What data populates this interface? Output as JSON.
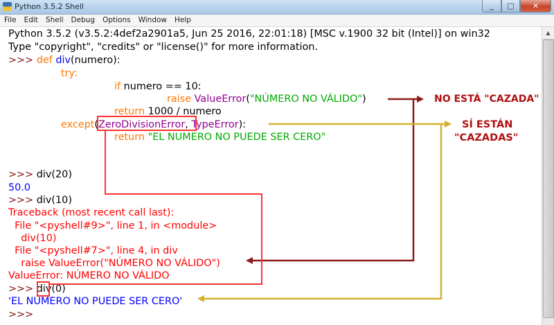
{
  "window": {
    "title": "Python 3.5.2 Shell",
    "minimize": "_",
    "maximize": "□",
    "close": "✕"
  },
  "menu": [
    "File",
    "Edit",
    "Shell",
    "Debug",
    "Options",
    "Window",
    "Help"
  ],
  "shell": {
    "banner1": "Python 3.5.2 (v3.5.2:4def2a2901a5, Jun 25 2016, 22:01:18) [MSC v.1900 32 bit (Intel)] on win32",
    "banner2": "Type \"copyright\", \"credits\" or \"license()\" for more information.",
    "prompt": ">>> ",
    "def_kw": "def",
    "def_name": "div",
    "def_rest": "(numero):",
    "try_kw": "try:",
    "if_kw": "if",
    "if_rest": " numero == 10:",
    "raise_kw": "raise",
    "raise_cls": "ValueError",
    "raise_str": "\"NÚMERO NO VÁLIDO\"",
    "return_kw": "return",
    "return_rest": " 1000 / numero",
    "except_kw": "except",
    "except_cls1": "ZeroDivisionError",
    "except_cls2": "TypeError",
    "return2_str": "\"EL NUMERO NO PUEDE SER CERO\"",
    "call1": "div(20)",
    "out1": "50.0",
    "call2": "div(10)",
    "tb1": "Traceback (most recent call last):",
    "tb2": "  File \"<pyshell#9>\", line 1, in <module>",
    "tb3": "    div(10)",
    "tb4": "  File \"<pyshell#7>\", line 4, in div",
    "tb5": "    raise ValueError(\"NÚMERO NO VÁLIDO\")",
    "tb6": "ValueError: NÚMERO NO VÁLIDO",
    "call3_pre": "div(",
    "call3_arg": "0",
    "call3_post": ")",
    "out3": "'EL NÚMERO NO PUEDE SER CERO'",
    "final_prompt": ">>>"
  },
  "annotations": {
    "not_caught": "NO ESTÁ \"CAZADA\"",
    "caught_line1": "SÍ ESTÁN",
    "caught_line2": "\"CAZADAS\""
  },
  "colors": {
    "dark_red_arrow": "#8b1a1a",
    "red_box": "#ff3030",
    "gold_arrow": "#d4b030",
    "prompt": "#7f1010",
    "keyword": "#ff7700",
    "string": "#00aa00",
    "builtin": "#900090",
    "output": "#0000ff",
    "error": "#ff0000"
  }
}
